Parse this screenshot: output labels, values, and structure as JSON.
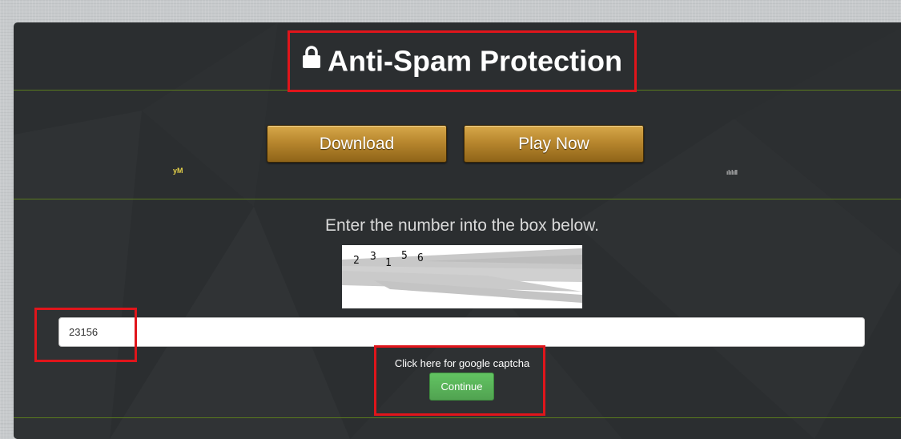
{
  "header": {
    "title": "Anti-Spam Protection",
    "lock_icon": "lock-icon"
  },
  "game_buttons": {
    "download_label": "Download",
    "play_label": "Play Now"
  },
  "tiny_marks": {
    "left": "yM",
    "right": "ılılıll"
  },
  "captcha": {
    "instruction": "Enter the number into the box below.",
    "digits": [
      "2",
      "3",
      "1",
      "5",
      "6"
    ],
    "answer_value": "23156",
    "google_captcha_link": "Click here for google captcha",
    "continue_label": "Continue"
  },
  "colors": {
    "panel": "#2b2e30",
    "rule": "#5a7a1e",
    "button_gold": "#b8872e",
    "continue_green": "#5cb85c",
    "highlight_red": "#e0151b"
  }
}
